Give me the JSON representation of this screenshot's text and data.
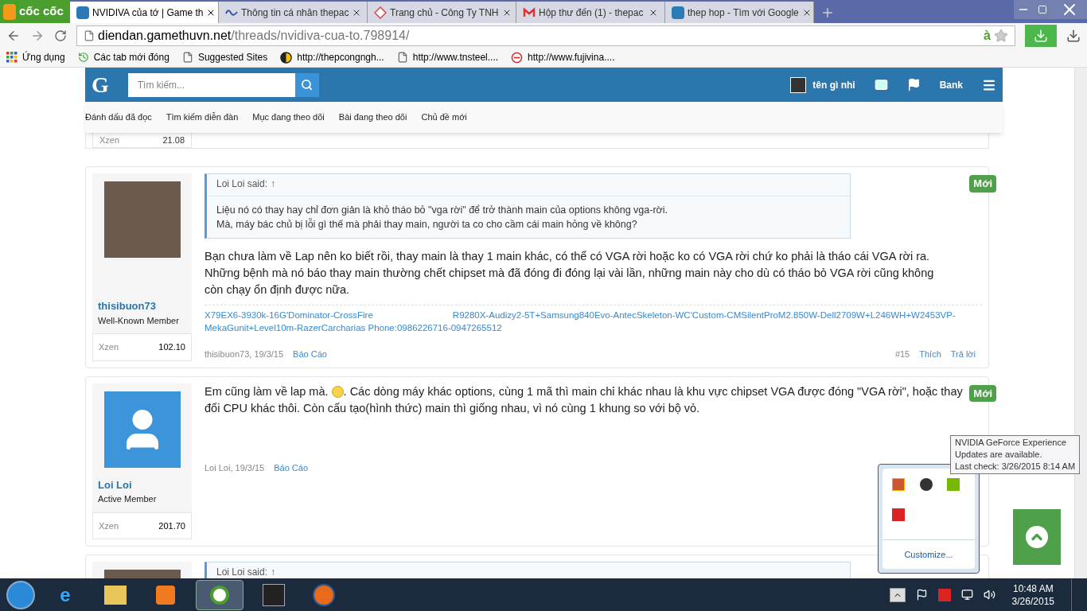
{
  "browser": {
    "logo": "cốc cốc",
    "tabs": [
      {
        "title": "NVIDIVA của tớ | Game th",
        "selected": true,
        "kind": "g"
      },
      {
        "title": "Thông tin cá nhân thepac",
        "selected": false,
        "kind": "wave"
      },
      {
        "title": "Trang chủ - Công Ty TNH",
        "selected": false,
        "kind": "diamond"
      },
      {
        "title": "Hộp thư đến (1) - thepac",
        "selected": false,
        "kind": "mail"
      },
      {
        "title": "thep hop - Tìm với Google",
        "selected": false,
        "kind": "g"
      }
    ],
    "address": {
      "domain": "diendan.gamethuvn.net",
      "path": "/threads/nvidiva-cua-to.798914/",
      "ext": "à"
    },
    "bookmarks": [
      {
        "label": "Ứng dụng",
        "kind": "apps"
      },
      {
        "label": "Các tab mới đóng",
        "kind": "history"
      },
      {
        "label": "Suggested Sites",
        "kind": "page"
      },
      {
        "label": "http://thepcongngh...",
        "kind": "circle"
      },
      {
        "label": "http://www.tnsteel....",
        "kind": "page"
      },
      {
        "label": "http://www.fujivina....",
        "kind": "e"
      }
    ]
  },
  "site": {
    "logo": "G",
    "search_placeholder": "Tìm kiếm...",
    "user": "tên gì nhỉ",
    "bank": "Bank",
    "nav": [
      "Đánh dấu đã đọc",
      "Tìm kiếm diễn đàn",
      "Mục đang theo dõi",
      "Bài đang theo dõi",
      "Chủ đề mới"
    ]
  },
  "previous_post": {
    "stat_label": "Xzen",
    "stat_value": "21.08"
  },
  "posts": [
    {
      "kind": "full",
      "author": "thisibuon73",
      "role": "Well-Known Member",
      "stat_label": "Xzen",
      "stat_value": "102.10",
      "badge": "Mới",
      "quote": {
        "author": "Loi Loi said:",
        "arrow": "↑",
        "lines": [
          "Liệu nó có thay hay chỉ đơn giản là khỏ tháo bỏ \"vga rời\" để trở thành main của options không vga-rời.",
          "Mà, máy bác chủ bị lỗi gì thế mà phải thay main, người ta co cho cầm cái main hỏng về không?"
        ]
      },
      "body": [
        "Bạn chưa làm về Lap nên ko biết rồi, thay main là thay 1 main khác, có thể có VGA rời hoặc ko có VGA rời chứ ko phải là tháo cái VGA rời ra.",
        "Những bệnh mà nó báo thay main thường chết chipset mà đã đóng đi đóng lại vài lần, những main này cho dù có tháo bỏ VGA rời cũng không",
        "còn chạy ổn định được nữa."
      ],
      "signature": [
        "X79EX6-3930k-16G'Dominator-CrossFire",
        "R9280X-Audizy2-5T+Samsung840Evo-AntecSkeleton-WC'Custom-CMSilentProM2.850W-Dell2709W+L246WH+W2453VP-",
        "MekaGunit+Level10m-RazerCarcharias Phone:0986226716-0947265512"
      ],
      "meta": "thisibuon73, 19/3/15",
      "report": "Báo Cáo",
      "number": "#15",
      "like": "Thích",
      "reply": "Trả lời"
    },
    {
      "kind": "emoji",
      "author": "Loi Loi",
      "role": "Active Member",
      "stat_label": "Xzen",
      "stat_value": "201.70",
      "badge": "Mới",
      "body_before": "Em cũng làm về lap mà.",
      "body_after": ". Các dòng máy khác options, cùng 1 mã thì main chỉ khác nhau là khu vực chipset VGA được đóng \"VGA rời\", hoặc thay đổi CPU khác thôi. Còn cấu tạo(hình thức) main thì giống nhau, vì nó cùng 1 khung so với bộ vỏ.",
      "meta": "Loi Loi, 19/3/15",
      "report": "Báo Cáo"
    },
    {
      "kind": "partial",
      "quote": {
        "author": "Loi Loi said:",
        "arrow": "↑"
      }
    }
  ],
  "tooltip": [
    "NVIDIA GeForce Experience",
    "Updates are available.",
    "Last check: 3/26/2015 8:14 AM"
  ],
  "tray_popup": {
    "customize": "Customize..."
  },
  "taskbar": {
    "time": "10:48 AM",
    "date": "3/26/2015"
  }
}
